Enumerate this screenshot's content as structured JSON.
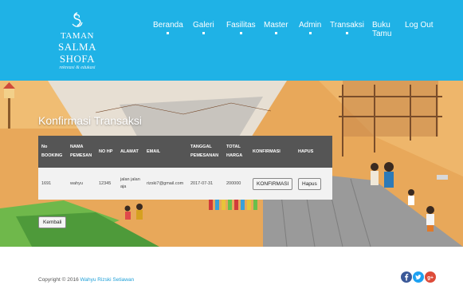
{
  "brand": {
    "line1": "TAMAN",
    "line2": "SALMA SHOFA",
    "tagline": "rekreasi & edukasi"
  },
  "nav": {
    "items": [
      {
        "label": "Beranda",
        "dot": true
      },
      {
        "label": "Galeri",
        "dot": true
      },
      {
        "label": "Fasilitas",
        "dot": true
      },
      {
        "label": "Master",
        "dot": true
      },
      {
        "label": "Admin",
        "dot": true
      },
      {
        "label": "Transaksi",
        "dot": true
      },
      {
        "label": "Buku Tamu",
        "dot": false
      },
      {
        "label": "Log Out",
        "dot": false
      }
    ]
  },
  "page": {
    "title": "Konfirmasi Transaksi"
  },
  "table": {
    "headers": [
      "No BOOKING",
      "NAMA PEMESAN",
      "NO HP",
      "ALAMAT",
      "EMAIL",
      "TANGGAL PEMESANAN",
      "TOTAL HARGA",
      "KONFIRMASI",
      "HAPUS"
    ],
    "rows": [
      {
        "no_booking": "1691",
        "nama": "wahyu",
        "hp": "12345",
        "alamat": "jalan jalan aja",
        "email": "rizski7@gmail.com",
        "tanggal": "2017-07-31",
        "total": "200000",
        "konfirmasi_label": "KONFIRMASI",
        "hapus_label": "Hapus"
      }
    ]
  },
  "back_button": "Kembali",
  "footer": {
    "copyright": "Copyright © 2016",
    "author": "Wahyu Rizski Setiawan"
  },
  "social": [
    {
      "icon": "facebook-icon",
      "color": "#3b5998"
    },
    {
      "icon": "twitter-icon",
      "color": "#1da1f2"
    },
    {
      "icon": "google-plus-icon",
      "color": "#dd4b39"
    }
  ],
  "colors": {
    "header": "#1fb2e6",
    "table_header": "#555555",
    "link": "#1fa0d8"
  }
}
